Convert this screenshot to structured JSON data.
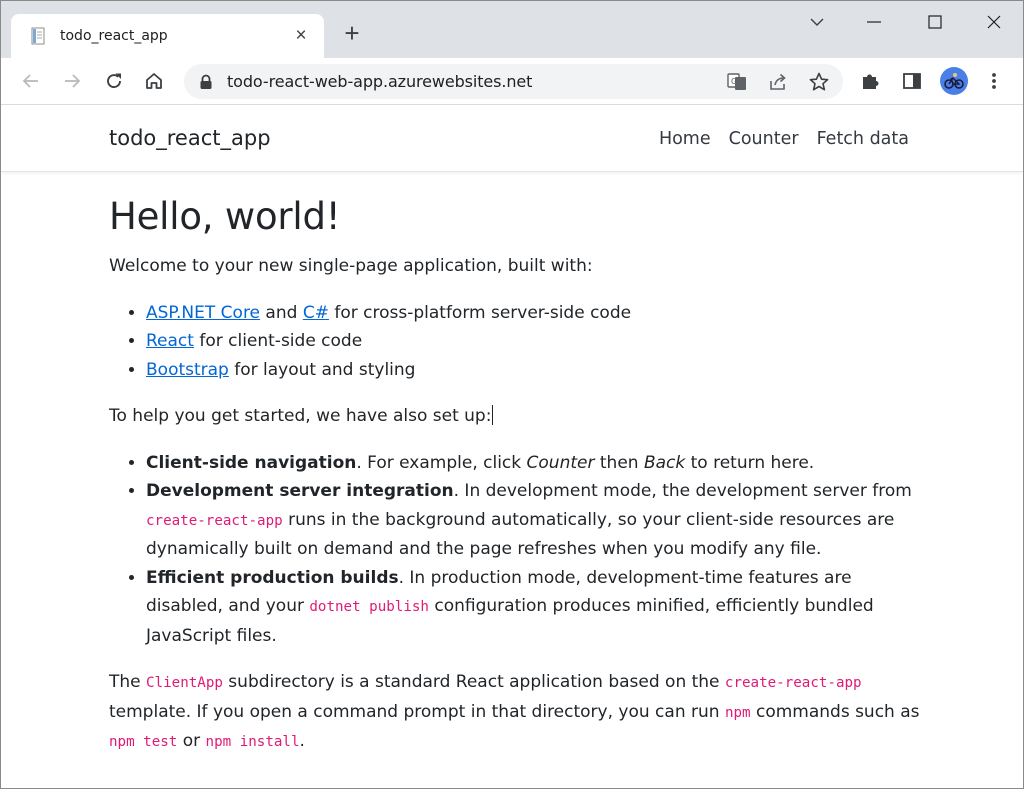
{
  "browser": {
    "tab_title": "todo_react_app",
    "new_tab_label": "+",
    "close_tab_label": "×",
    "url": "todo-react-web-app.azurewebsites.net"
  },
  "app": {
    "brand": "todo_react_app",
    "nav": [
      "Home",
      "Counter",
      "Fetch data"
    ]
  },
  "content": {
    "heading": "Hello, world!",
    "intro": "Welcome to your new single-page application, built with:",
    "built_with": [
      {
        "links": [
          "ASP.NET Core",
          "C#"
        ],
        "joiner": " and ",
        "text": " for cross-platform server-side code"
      },
      {
        "links": [
          "React"
        ],
        "text": " for client-side code"
      },
      {
        "links": [
          "Bootstrap"
        ],
        "text": " for layout and styling"
      }
    ],
    "setup_intro": "To help you get started, we have also set up:",
    "features": [
      {
        "bold": "Client-side navigation",
        "t1": ". For example, click ",
        "em1": "Counter",
        "t2": " then ",
        "em2": "Back",
        "t3": " to return here."
      },
      {
        "bold": "Development server integration",
        "t1": ". In development mode, the development server from ",
        "code": "create-react-app",
        "t2": " runs in the background automatically, so your client-side resources are dynamically built on demand and the page refreshes when you modify any file."
      },
      {
        "bold": "Efficient production builds",
        "t1": ". In production mode, development-time features are disabled, and your ",
        "code": "dotnet publish",
        "t2": " configuration produces minified, efficiently bundled JavaScript files."
      }
    ],
    "closing": {
      "t1": "The ",
      "c1": "ClientApp",
      "t2": " subdirectory is a standard React application based on the ",
      "c2": "create-react-app",
      "t3": " template. If you open a command prompt in that directory, you can run ",
      "c3": "npm",
      "t4": " commands such as ",
      "c4": "npm test",
      "t5": " or ",
      "c5": "npm install",
      "t6": "."
    }
  },
  "colors": {
    "link": "#0366d6",
    "code": "#e01a76",
    "tabstrip": "#dee1e6",
    "omnibox": "#f1f3f4"
  }
}
